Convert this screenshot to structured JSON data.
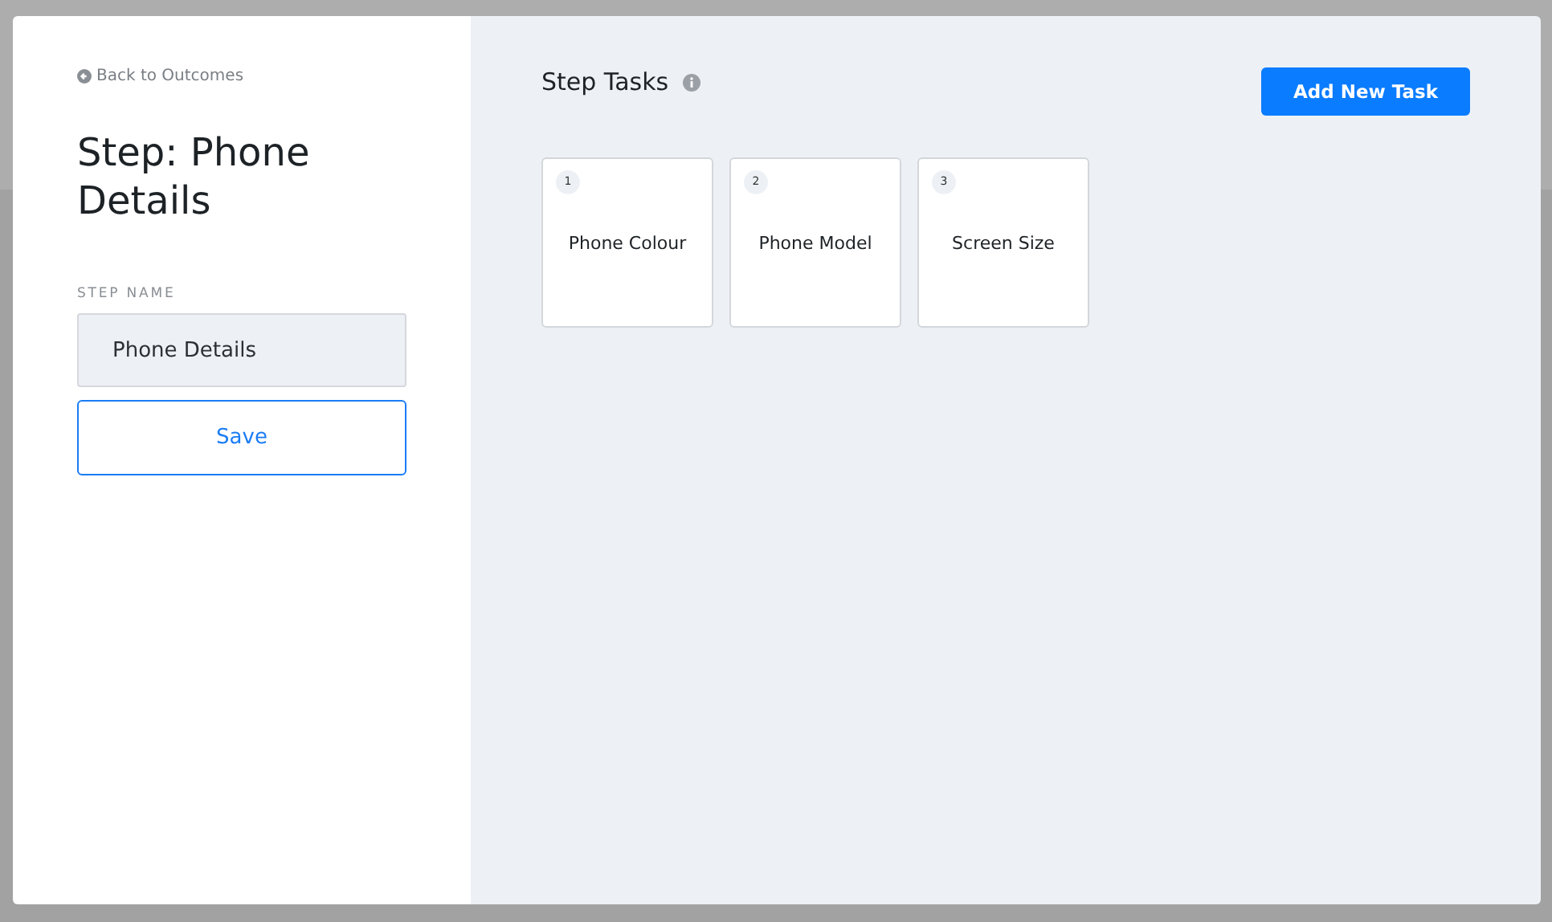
{
  "back_link": {
    "label": "Back to Outcomes"
  },
  "step": {
    "title": "Step: Phone Details",
    "field_label": "STEP NAME",
    "name_value": "Phone Details",
    "save_button": "Save"
  },
  "tasks_panel": {
    "title": "Step Tasks",
    "add_button": "Add New Task",
    "tasks": [
      {
        "number": "1",
        "name": "Phone Colour"
      },
      {
        "number": "2",
        "name": "Phone Model"
      },
      {
        "number": "3",
        "name": "Screen Size"
      }
    ]
  }
}
